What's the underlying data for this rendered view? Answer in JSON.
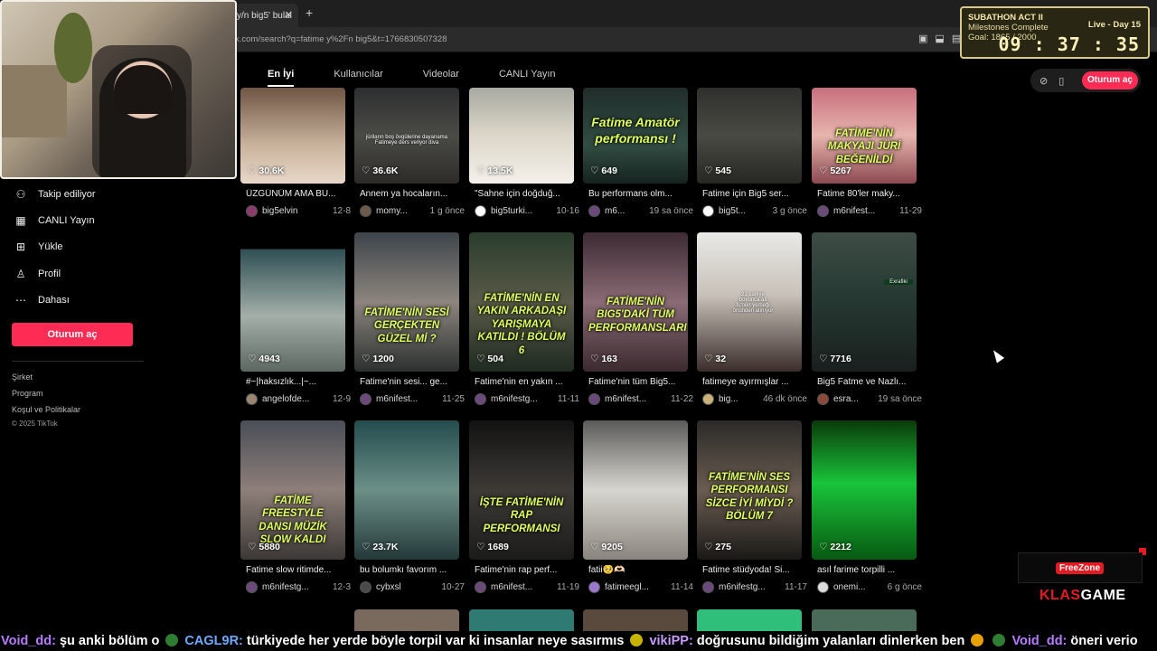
{
  "browser": {
    "tab_title": "y/n big5' bulal",
    "tab_close": "✕",
    "new_tab": "+",
    "url": "k.com/search?q=fatime y%2Fn big5&t=1766830507328"
  },
  "search_tabs": [
    {
      "label": "En İyi",
      "active": true
    },
    {
      "label": "Kullanıcılar",
      "active": false
    },
    {
      "label": "Videolar",
      "active": false
    },
    {
      "label": "CANLI Yayın",
      "active": false
    }
  ],
  "top_controls": {
    "login_label": "Oturum aç"
  },
  "subathon": {
    "title": "SUBATHON ACT II",
    "line1": "Milestones Complete",
    "goal": "Goal: 1865 / 2000",
    "live": "Live - Day 15",
    "timer": "09 : 37 : 35"
  },
  "sidebar": {
    "items": [
      {
        "label": "Takip ediliyor",
        "icon": "following-icon"
      },
      {
        "label": "CANLI Yayın",
        "icon": "live-icon"
      },
      {
        "label": "Yükle",
        "icon": "upload-icon"
      },
      {
        "label": "Profil",
        "icon": "profile-icon"
      },
      {
        "label": "Dahası",
        "icon": "more-icon"
      }
    ],
    "login_label": "Oturum aç",
    "footer": [
      "Şirket",
      "Program",
      "Koşul ve Politikalar",
      "© 2025 TikTok"
    ]
  },
  "videos": [
    {
      "likes": "30.6K",
      "title": "ÜZGÜNÜM AMA BU...",
      "author": "big5elvin",
      "date": "12-8",
      "overlay": "",
      "caption": ""
    },
    {
      "likes": "36.6K",
      "title": "Annem ya hocaların...",
      "author": "momy...",
      "date": "1 g önce",
      "overlay": "",
      "caption": "jüriların boş övgülerine dayanama Fatimeye ders veriyor diva"
    },
    {
      "likes": "13.5K",
      "title": "\"Sahne için doğduğ...",
      "author": "big5turki...",
      "date": "10-16",
      "overlay": "",
      "caption": ""
    },
    {
      "likes": "649",
      "title": "Bu performans olm...",
      "author": "m6...",
      "date": "19 sa önce",
      "overlay": "Fatime Amatör performansı !",
      "caption": ""
    },
    {
      "likes": "545",
      "title": "Fatime için Big5 ser...",
      "author": "big5t...",
      "date": "3 g önce",
      "overlay": "",
      "caption": ""
    },
    {
      "likes": "5267",
      "title": "Fatime 80'ler maky...",
      "author": "m6nifest...",
      "date": "11-29",
      "overlay": "FATİME'NİN MAKYAJI JÜRİ BEĞENİLDİ",
      "caption": ""
    },
    {
      "likes": "4943",
      "title": "#~|haksızlık...|~...",
      "author": "angelofde...",
      "date": "12-9",
      "overlay": "",
      "caption": ""
    },
    {
      "likes": "1200",
      "title": "Fatime'nin sesi... ge...",
      "author": "m6nifest...",
      "date": "11-25",
      "overlay": "FATİME'NİN SESİ GERÇEKTEN GÜZEL Mİ ?",
      "caption": ""
    },
    {
      "likes": "504",
      "title": "Fatime'nin en yakın ...",
      "author": "m6nifestg...",
      "date": "11-11",
      "overlay": "FATİME'NİN EN YAKIN ARKADAŞI YARIŞMAYA KATILDI ! BÖLÜM 6",
      "caption": ""
    },
    {
      "likes": "163",
      "title": "Fatime'nin tüm Big5...",
      "author": "m6nifest...",
      "date": "11-22",
      "overlay": "FATİME'NİN BIG5'DAKİ TÜM PERFORMANSLARI",
      "caption": ""
    },
    {
      "likes": "32",
      "title": "fatimeye ayırmışlar ...",
      "author": "big...",
      "date": "46 dk önce",
      "overlay": "",
      "caption": "23 saniye boyunca ali fu'nun yemeği önünden alınıyor"
    },
    {
      "likes": "7716",
      "title": "Big5 Fatme ve Nazlı...",
      "author": "esra...",
      "date": "19 sa önce",
      "overlay": "",
      "caption": "Exrafiki"
    },
    {
      "likes": "5880",
      "title": "Fatime slow ritimde...",
      "author": "m6nifestg...",
      "date": "12-3",
      "overlay": "FATİME FREESTYLE DANSI MÜZİK SLOW KALDI",
      "caption": ""
    },
    {
      "likes": "23.7K",
      "title": "bu bolumkı favorım ...",
      "author": "cybxsl",
      "date": "10-27",
      "overlay": "",
      "caption": ""
    },
    {
      "likes": "1689",
      "title": "Fatime'nin rap perf...",
      "author": "m6nifest...",
      "date": "11-19",
      "overlay": "İŞTE FATİME'NİN RAP PERFORMANSI",
      "caption": ""
    },
    {
      "likes": "9205",
      "title": "fatii🥺🫶🏻",
      "author": "fatimeegl...",
      "date": "11-14",
      "overlay": "",
      "caption": ""
    },
    {
      "likes": "275",
      "title": "Fatime stüdyoda! Si...",
      "author": "m6nifestg...",
      "date": "11-17",
      "overlay": "FATİME'NİN SES PERFORMANSI SİZCE İYİ MİYDİ ? BÖLÜM 7",
      "caption": ""
    },
    {
      "likes": "2212",
      "title": "asıl farime torpilli ...",
      "author": "onemi...",
      "date": "6 g önce",
      "overlay": "",
      "caption": ""
    }
  ],
  "overlays": {
    "freezone": "FreeZone",
    "brand_prefix": "KLAS",
    "brand_suffix": "GAME"
  },
  "ticker": {
    "user1": "Void_dd:",
    "msg1": "şu anki bölüm o",
    "user2": "CAGL9R:",
    "msg2": "türkiyede her yerde böyle torpil var ki insanlar neye sasırmıs",
    "user3": "vikiPP:",
    "msg3": "doğrusunu bildiğim yalanları dinlerken ben",
    "user4": "Void_dd:",
    "msg4": "öneri verio"
  }
}
